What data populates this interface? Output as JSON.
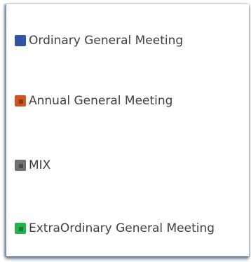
{
  "legend": {
    "items": [
      {
        "label": "Ordinary General Meeting",
        "color": "#2f54a3",
        "inner_color": "#2f54a3"
      },
      {
        "label": "Annual General Meeting",
        "color": "#d0541c",
        "inner_color": "#8a3a14"
      },
      {
        "label": "MIX",
        "color": "#6f6f6f",
        "inner_color": "#4a4a4a"
      },
      {
        "label": "ExtraOrdinary General Meeting",
        "color": "#1fb34a",
        "inner_color": "#0f7a30"
      }
    ]
  }
}
